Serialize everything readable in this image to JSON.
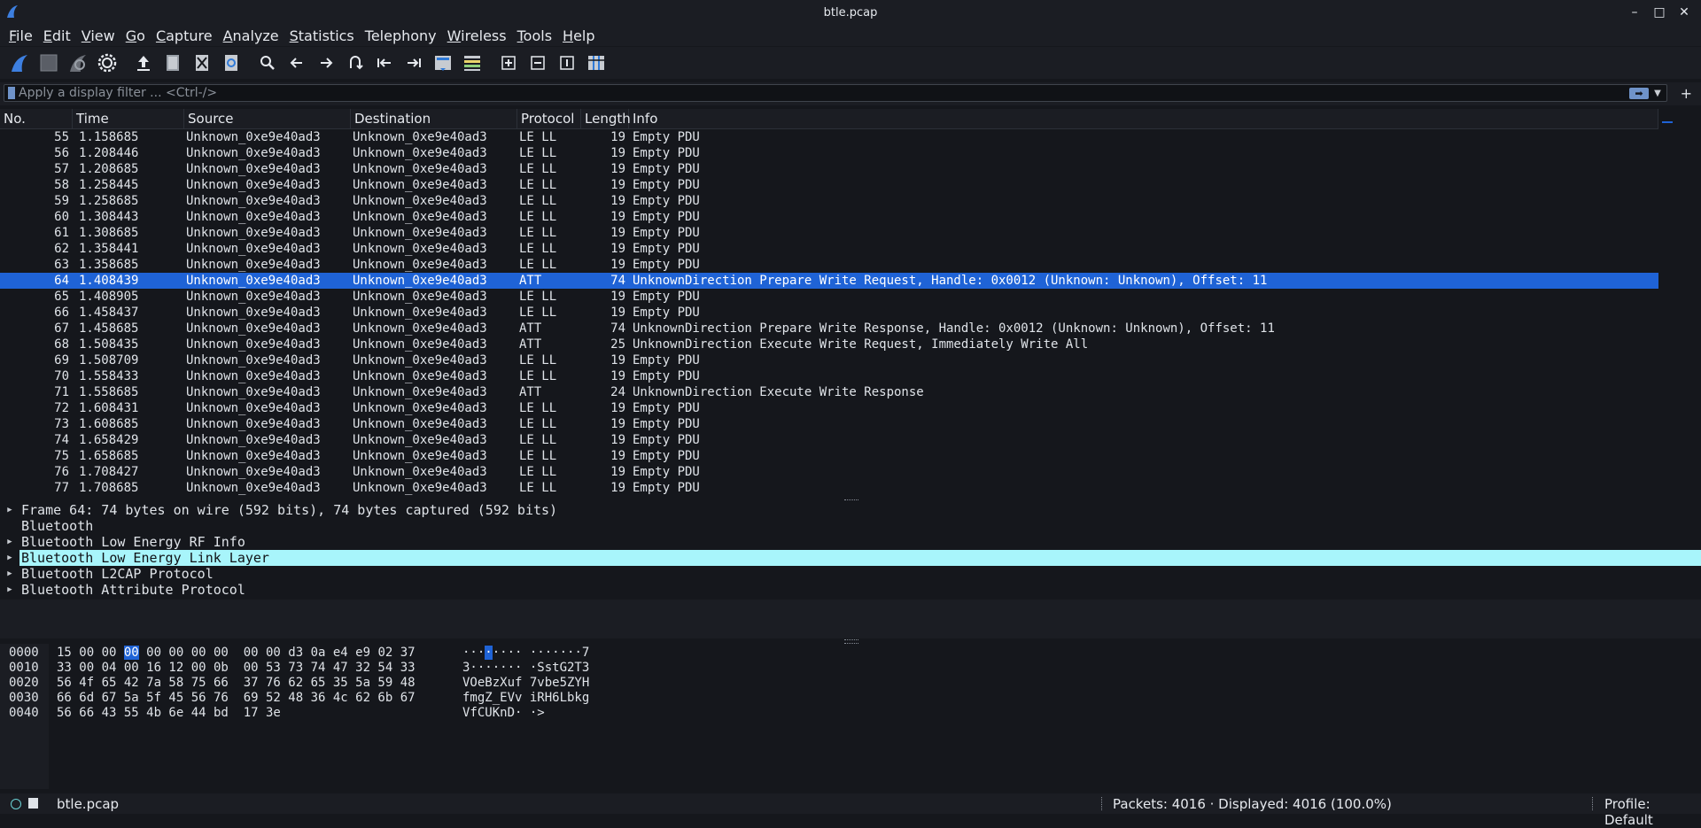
{
  "window": {
    "title": "btle.pcap"
  },
  "menu": [
    {
      "label": "File",
      "u": "F",
      "rest": "ile"
    },
    {
      "label": "Edit",
      "u": "E",
      "rest": "dit"
    },
    {
      "label": "View",
      "u": "V",
      "rest": "iew"
    },
    {
      "label": "Go",
      "u": "G",
      "rest": "o"
    },
    {
      "label": "Capture",
      "u": "C",
      "rest": "apture"
    },
    {
      "label": "Analyze",
      "u": "A",
      "rest": "nalyze"
    },
    {
      "label": "Statistics",
      "u": "S",
      "rest": "tatistics"
    },
    {
      "label": "Telephony",
      "u": "",
      "rest": "Telephony"
    },
    {
      "label": "Wireless",
      "u": "W",
      "rest": "ireless"
    },
    {
      "label": "Tools",
      "u": "T",
      "rest": "ools"
    },
    {
      "label": "Help",
      "u": "H",
      "rest": "elp"
    }
  ],
  "toolbar": {
    "icons": [
      "shark-fin-start-icon",
      "stop-square-icon",
      "shark-fin-restart-icon",
      "gear-options-icon",
      "open-file-icon",
      "save-file-icon",
      "close-file-icon",
      "reload-file-icon",
      "search-icon",
      "go-back-icon",
      "go-forward-icon",
      "go-to-packet-icon",
      "first-packet-icon",
      "last-packet-icon",
      "autoscroll-icon",
      "colorize-icon",
      "zoom-in-icon",
      "zoom-out-icon",
      "zoom-normal-icon",
      "resize-columns-icon"
    ]
  },
  "filter": {
    "placeholder": "Apply a display filter ... <Ctrl-/>",
    "value": ""
  },
  "columns": {
    "no": "No.",
    "time": "Time",
    "source": "Source",
    "destination": "Destination",
    "protocol": "Protocol",
    "length": "Length",
    "info": "Info"
  },
  "packets": [
    {
      "no": "55",
      "time": "1.158685",
      "src": "Unknown_0xe9e40ad3",
      "dst": "Unknown_0xe9e40ad3",
      "proto": "LE LL",
      "len": "19",
      "info": "Empty PDU"
    },
    {
      "no": "56",
      "time": "1.208446",
      "src": "Unknown_0xe9e40ad3",
      "dst": "Unknown_0xe9e40ad3",
      "proto": "LE LL",
      "len": "19",
      "info": "Empty PDU"
    },
    {
      "no": "57",
      "time": "1.208685",
      "src": "Unknown_0xe9e40ad3",
      "dst": "Unknown_0xe9e40ad3",
      "proto": "LE LL",
      "len": "19",
      "info": "Empty PDU"
    },
    {
      "no": "58",
      "time": "1.258445",
      "src": "Unknown_0xe9e40ad3",
      "dst": "Unknown_0xe9e40ad3",
      "proto": "LE LL",
      "len": "19",
      "info": "Empty PDU"
    },
    {
      "no": "59",
      "time": "1.258685",
      "src": "Unknown_0xe9e40ad3",
      "dst": "Unknown_0xe9e40ad3",
      "proto": "LE LL",
      "len": "19",
      "info": "Empty PDU"
    },
    {
      "no": "60",
      "time": "1.308443",
      "src": "Unknown_0xe9e40ad3",
      "dst": "Unknown_0xe9e40ad3",
      "proto": "LE LL",
      "len": "19",
      "info": "Empty PDU"
    },
    {
      "no": "61",
      "time": "1.308685",
      "src": "Unknown_0xe9e40ad3",
      "dst": "Unknown_0xe9e40ad3",
      "proto": "LE LL",
      "len": "19",
      "info": "Empty PDU"
    },
    {
      "no": "62",
      "time": "1.358441",
      "src": "Unknown_0xe9e40ad3",
      "dst": "Unknown_0xe9e40ad3",
      "proto": "LE LL",
      "len": "19",
      "info": "Empty PDU"
    },
    {
      "no": "63",
      "time": "1.358685",
      "src": "Unknown_0xe9e40ad3",
      "dst": "Unknown_0xe9e40ad3",
      "proto": "LE LL",
      "len": "19",
      "info": "Empty PDU"
    },
    {
      "no": "64",
      "time": "1.408439",
      "src": "Unknown_0xe9e40ad3",
      "dst": "Unknown_0xe9e40ad3",
      "proto": "ATT",
      "len": "74",
      "info": "UnknownDirection Prepare Write Request, Handle: 0x0012 (Unknown: Unknown), Offset: 11",
      "selected": true
    },
    {
      "no": "65",
      "time": "1.408905",
      "src": "Unknown_0xe9e40ad3",
      "dst": "Unknown_0xe9e40ad3",
      "proto": "LE LL",
      "len": "19",
      "info": "Empty PDU"
    },
    {
      "no": "66",
      "time": "1.458437",
      "src": "Unknown_0xe9e40ad3",
      "dst": "Unknown_0xe9e40ad3",
      "proto": "LE LL",
      "len": "19",
      "info": "Empty PDU"
    },
    {
      "no": "67",
      "time": "1.458685",
      "src": "Unknown_0xe9e40ad3",
      "dst": "Unknown_0xe9e40ad3",
      "proto": "ATT",
      "len": "74",
      "info": "UnknownDirection Prepare Write Response, Handle: 0x0012 (Unknown: Unknown), Offset: 11"
    },
    {
      "no": "68",
      "time": "1.508435",
      "src": "Unknown_0xe9e40ad3",
      "dst": "Unknown_0xe9e40ad3",
      "proto": "ATT",
      "len": "25",
      "info": "UnknownDirection Execute Write Request, Immediately Write All"
    },
    {
      "no": "69",
      "time": "1.508709",
      "src": "Unknown_0xe9e40ad3",
      "dst": "Unknown_0xe9e40ad3",
      "proto": "LE LL",
      "len": "19",
      "info": "Empty PDU"
    },
    {
      "no": "70",
      "time": "1.558433",
      "src": "Unknown_0xe9e40ad3",
      "dst": "Unknown_0xe9e40ad3",
      "proto": "LE LL",
      "len": "19",
      "info": "Empty PDU"
    },
    {
      "no": "71",
      "time": "1.558685",
      "src": "Unknown_0xe9e40ad3",
      "dst": "Unknown_0xe9e40ad3",
      "proto": "ATT",
      "len": "24",
      "info": "UnknownDirection Execute Write Response"
    },
    {
      "no": "72",
      "time": "1.608431",
      "src": "Unknown_0xe9e40ad3",
      "dst": "Unknown_0xe9e40ad3",
      "proto": "LE LL",
      "len": "19",
      "info": "Empty PDU"
    },
    {
      "no": "73",
      "time": "1.608685",
      "src": "Unknown_0xe9e40ad3",
      "dst": "Unknown_0xe9e40ad3",
      "proto": "LE LL",
      "len": "19",
      "info": "Empty PDU"
    },
    {
      "no": "74",
      "time": "1.658429",
      "src": "Unknown_0xe9e40ad3",
      "dst": "Unknown_0xe9e40ad3",
      "proto": "LE LL",
      "len": "19",
      "info": "Empty PDU"
    },
    {
      "no": "75",
      "time": "1.658685",
      "src": "Unknown_0xe9e40ad3",
      "dst": "Unknown_0xe9e40ad3",
      "proto": "LE LL",
      "len": "19",
      "info": "Empty PDU"
    },
    {
      "no": "76",
      "time": "1.708427",
      "src": "Unknown_0xe9e40ad3",
      "dst": "Unknown_0xe9e40ad3",
      "proto": "LE LL",
      "len": "19",
      "info": "Empty PDU"
    },
    {
      "no": "77",
      "time": "1.708685",
      "src": "Unknown_0xe9e40ad3",
      "dst": "Unknown_0xe9e40ad3",
      "proto": "LE LL",
      "len": "19",
      "info": "Empty PDU"
    }
  ],
  "details": [
    {
      "text": "Frame 64: 74 bytes on wire (592 bits), 74 bytes captured (592 bits)",
      "expandable": true
    },
    {
      "text": "Bluetooth",
      "expandable": false
    },
    {
      "text": "Bluetooth Low Energy RF Info",
      "expandable": true
    },
    {
      "text": "Bluetooth Low Energy Link Layer",
      "expandable": true,
      "selected": true
    },
    {
      "text": "Bluetooth L2CAP Protocol",
      "expandable": true
    },
    {
      "text": "Bluetooth Attribute Protocol",
      "expandable": true
    }
  ],
  "bytes": [
    {
      "offset": "0000",
      "hex_pre": "15 00 00 ",
      "hex_hl": "00",
      "hex_post": " 00 00 00 00  00 00 d3 0a e4 e9 02 37",
      "ascii_pre": "···",
      "ascii_hl": "·",
      "ascii_post": "···· ·······7"
    },
    {
      "offset": "0010",
      "hex_pre": "33 00 04 00 16 12 00 0b  00 53 73 74 47 32 54 33",
      "hex_hl": "",
      "hex_post": "",
      "ascii_pre": "3······· ·SstG2T3",
      "ascii_hl": "",
      "ascii_post": ""
    },
    {
      "offset": "0020",
      "hex_pre": "56 4f 65 42 7a 58 75 66  37 76 62 65 35 5a 59 48",
      "hex_hl": "",
      "hex_post": "",
      "ascii_pre": "VOeBzXuf 7vbe5ZYH",
      "ascii_hl": "",
      "ascii_post": ""
    },
    {
      "offset": "0030",
      "hex_pre": "66 6d 67 5a 5f 45 56 76  69 52 48 36 4c 62 6b 67",
      "hex_hl": "",
      "hex_post": "",
      "ascii_pre": "fmgZ_EVv iRH6Lbkg",
      "ascii_hl": "",
      "ascii_post": ""
    },
    {
      "offset": "0040",
      "hex_pre": "56 66 43 55 4b 6e 44 bd  17 3e",
      "hex_hl": "",
      "hex_post": "",
      "ascii_pre": "VfCUKnD· ·>",
      "ascii_hl": "",
      "ascii_post": ""
    }
  ],
  "status": {
    "file": "btle.pcap",
    "packets": "Packets: 4016 · Displayed: 4016 (100.0%)",
    "profile": "Profile: Default"
  },
  "colors": {
    "selection": "#1f63d6",
    "detail_highlight": "#a8f5fb",
    "background": "#15171c"
  }
}
